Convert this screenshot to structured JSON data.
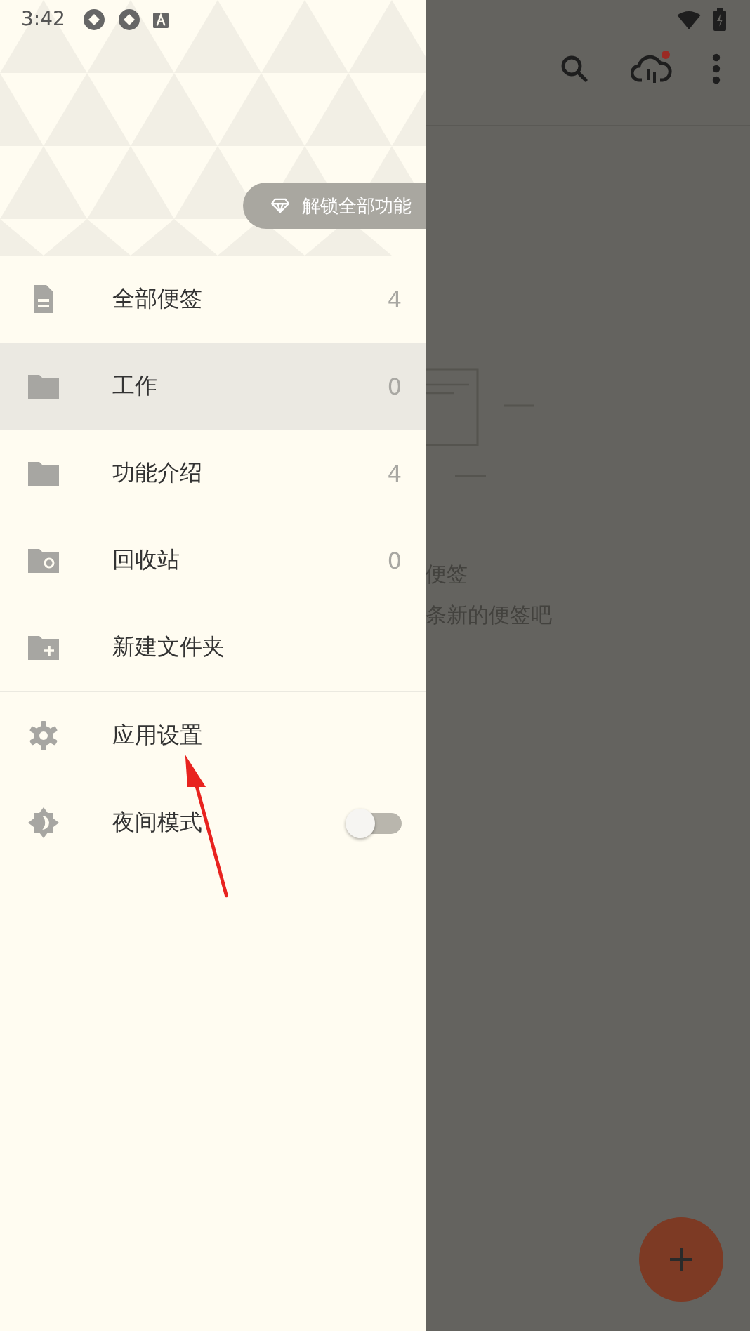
{
  "status_bar": {
    "time": "3:42"
  },
  "main": {
    "sync_unread": true,
    "empty_title": "便签",
    "empty_hint": "条新的便签吧"
  },
  "drawer": {
    "unlock_button": "解锁全部功能",
    "items": [
      {
        "label": "全部便签",
        "count": "4",
        "selected": false
      },
      {
        "label": "工作",
        "count": "0",
        "selected": true
      },
      {
        "label": "功能介绍",
        "count": "4",
        "selected": false
      },
      {
        "label": "回收站",
        "count": "0",
        "selected": false
      },
      {
        "label": "新建文件夹",
        "selected": false
      }
    ],
    "settings": [
      {
        "kind": "link",
        "label": "应用设置"
      },
      {
        "kind": "toggle",
        "label": "夜间模式",
        "on": false
      }
    ]
  }
}
